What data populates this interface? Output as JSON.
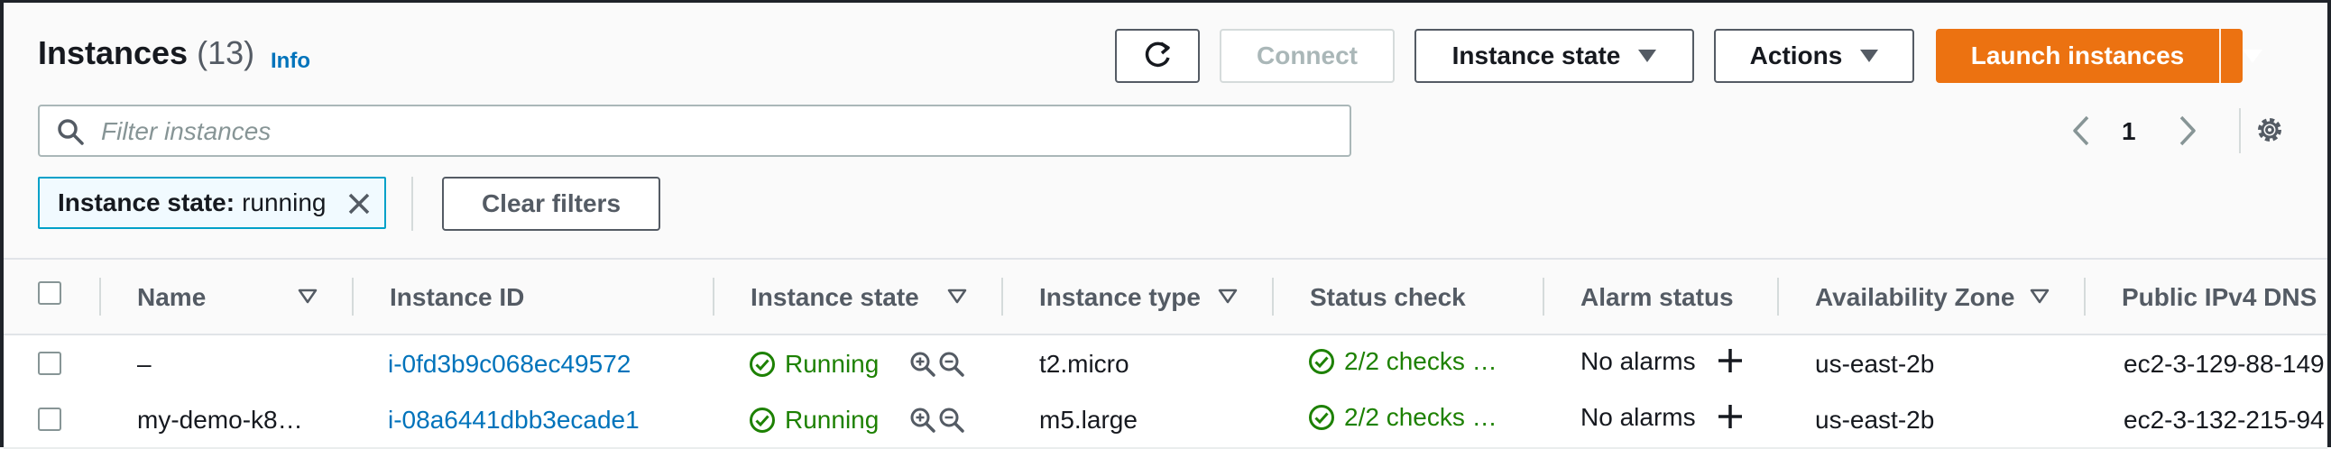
{
  "header": {
    "title": "Instances",
    "count": "(13)",
    "info": "Info"
  },
  "toolbar": {
    "connect": "Connect",
    "instance_state": "Instance state",
    "actions": "Actions",
    "launch": "Launch instances"
  },
  "search": {
    "placeholder": "Filter instances"
  },
  "pagination": {
    "page": "1"
  },
  "filter": {
    "key": "Instance state:",
    "value": "running",
    "clear": "Clear filters"
  },
  "table": {
    "columns": [
      "Name",
      "Instance ID",
      "Instance state",
      "Instance type",
      "Status check",
      "Alarm status",
      "Availability Zone",
      "Public IPv4 DNS"
    ],
    "rows": [
      {
        "name": "–",
        "instance_id": "i-0fd3b9c068ec49572",
        "state": "Running",
        "type": "t2.micro",
        "status_check": "2/2 checks …",
        "alarm": "No alarms",
        "zone": "us-east-2b",
        "dns": "ec2-3-129-88-149"
      },
      {
        "name": "my-demo-k8…",
        "instance_id": "i-08a6441dbb3ecade1",
        "state": "Running",
        "type": "m5.large",
        "status_check": "2/2 checks …",
        "alarm": "No alarms",
        "zone": "us-east-2b",
        "dns": "ec2-3-132-215-94"
      }
    ]
  },
  "colors": {
    "accent": "#ec7211",
    "link": "#0073bb",
    "success": "#1d8102",
    "filter_token": "#00a1c9"
  },
  "icons": [
    "refresh-icon",
    "search-icon",
    "chevron-left-icon",
    "chevron-right-icon",
    "settings-gear-icon",
    "close-icon",
    "sort-caret-icon",
    "check-circle-icon",
    "zoom-in-icon",
    "zoom-out-icon",
    "plus-icon"
  ]
}
